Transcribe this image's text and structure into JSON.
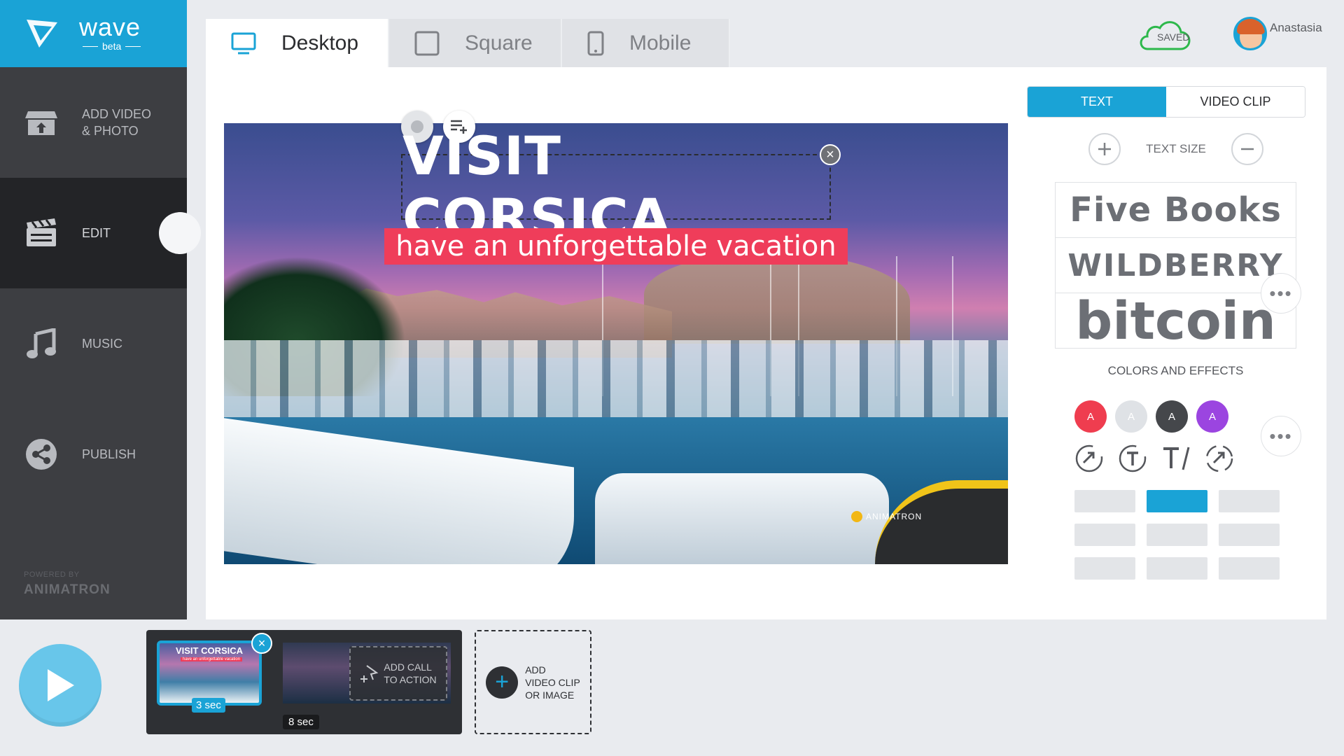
{
  "app": {
    "name": "wave",
    "tag": "beta",
    "powered_by": "POWERED BY",
    "powered_brand": "ANIMATRON",
    "accent_color": "#1aa3d6",
    "sidebar_color": "#3d3e42"
  },
  "sidebar": {
    "items": [
      {
        "label": "ADD VIDEO\n& PHOTO",
        "icon": "store-upload-icon",
        "active": false
      },
      {
        "label": "EDIT",
        "icon": "clapperboard-icon",
        "active": true
      },
      {
        "label": "MUSIC",
        "icon": "music-note-icon",
        "active": false
      },
      {
        "label": "PUBLISH",
        "icon": "share-icon",
        "active": false
      }
    ]
  },
  "tabs": [
    {
      "label": "Desktop",
      "icon": "desktop-icon",
      "active": true
    },
    {
      "label": "Square",
      "icon": "square-icon",
      "active": false
    },
    {
      "label": "Mobile",
      "icon": "mobile-icon",
      "active": false
    }
  ],
  "status": {
    "saved_label": "SAVED"
  },
  "user": {
    "name": "Anastasia"
  },
  "canvas": {
    "headline": "VISIT CORSICA",
    "subline": "have an unforgettable vacation",
    "watermark": "ANIMATRON",
    "subline_color": "#ef3d5a"
  },
  "panel": {
    "tabs": [
      {
        "label": "TEXT",
        "active": true
      },
      {
        "label": "VIDEO CLIP",
        "active": false
      }
    ],
    "text_size_label": "TEXT SIZE",
    "fonts": [
      "Five Books",
      "WILDBERRY",
      "bitcoin"
    ],
    "colors_label": "COLORS AND EFFECTS",
    "swatches": [
      {
        "label": "A",
        "color": "#ef3d4f"
      },
      {
        "label": "A",
        "color": "#dfe2e6"
      },
      {
        "label": "A",
        "color": "#45474b"
      },
      {
        "label": "A",
        "color": "#9b45e0"
      }
    ]
  },
  "timeline": {
    "clip1_title": "VISIT CORSICA",
    "clip1_sub": "have an unforgettable vacation",
    "clip1_duration": "3 sec",
    "clip2_duration": "8 sec",
    "cta_label": "ADD CALL\nTO ACTION",
    "add_clip_label": "ADD\nVIDEO CLIP\nOR IMAGE"
  }
}
